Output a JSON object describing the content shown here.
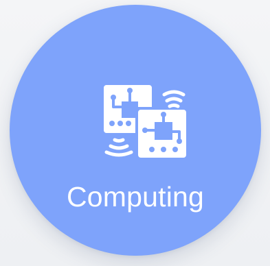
{
  "category": {
    "label": "Computing",
    "icon": "circuit-boards-wireless-icon",
    "color": "#7ea3fb"
  }
}
